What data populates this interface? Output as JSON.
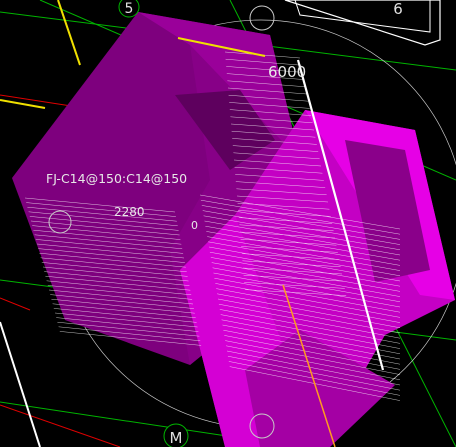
{
  "viewport": {
    "background": "#000000",
    "labels": {
      "grid_5": "5",
      "grid_6": "6",
      "grid_m": "M",
      "dim_6000": "6000",
      "rebar_note": "FJ-C14@150:C14@150",
      "dim_2280": "2280",
      "dim_0": "0"
    },
    "colors": {
      "grid_green": "#00b400",
      "red_line": "#e00000",
      "yellow": "#f0e000",
      "white": "#ffffff",
      "orange": "#ff9a20",
      "magenta_dark": "#7a007a",
      "magenta_mid": "#a000a0",
      "magenta_bright": "#e600e6"
    }
  }
}
